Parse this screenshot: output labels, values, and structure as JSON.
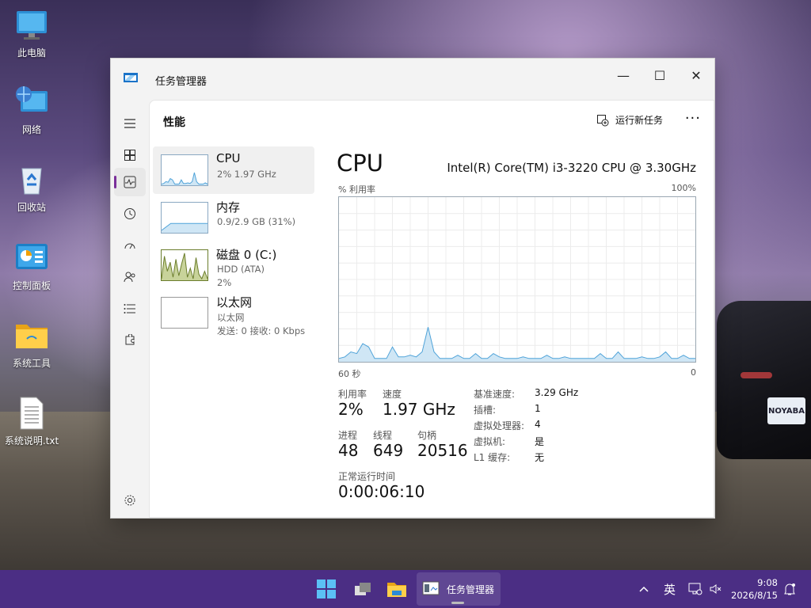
{
  "desktop": {
    "icons": [
      {
        "label": "此电脑"
      },
      {
        "label": "网络"
      },
      {
        "label": "回收站"
      },
      {
        "label": "控制面板"
      },
      {
        "label": "系统工具"
      },
      {
        "label": "系统说明.txt"
      }
    ],
    "car_plate": "NOYABA"
  },
  "window": {
    "title": "任务管理器",
    "controls": {
      "minimize": "—",
      "maximize": "☐",
      "close": "✕"
    }
  },
  "header": {
    "page_title": "性能",
    "run_task_label": "运行新任务",
    "more": "···"
  },
  "resources": [
    {
      "name": "CPU",
      "line1": "2% 1.97 GHz",
      "line2": ""
    },
    {
      "name": "内存",
      "line1": "0.9/2.9 GB (31%)",
      "line2": ""
    },
    {
      "name": "磁盘 0 (C:)",
      "line1": "HDD (ATA)",
      "line2": "2%"
    },
    {
      "name": "以太网",
      "line1": "以太网",
      "line2": "发送: 0 接收: 0 Kbps"
    }
  ],
  "detail": {
    "title": "CPU",
    "model": "Intel(R) Core(TM) i3-3220 CPU @ 3.30GHz",
    "util_label": "% 利用率",
    "util_max": "100%",
    "axis_left": "60 秒",
    "axis_right": "0",
    "stats": {
      "utilization_label": "利用率",
      "utilization": "2%",
      "speed_label": "速度",
      "speed": "1.97 GHz",
      "processes_label": "进程",
      "processes": "48",
      "threads_label": "线程",
      "threads": "649",
      "handles_label": "句柄",
      "handles": "20516",
      "uptime_label": "正常运行时间",
      "uptime": "0:00:06:10"
    },
    "info": [
      {
        "label": "基准速度:",
        "value": "3.29 GHz"
      },
      {
        "label": "插槽:",
        "value": "1"
      },
      {
        "label": "虚拟处理器:",
        "value": "4"
      },
      {
        "label": "虚拟机:",
        "value": "是"
      },
      {
        "label": "L1 缓存:",
        "value": "无"
      }
    ]
  },
  "chart_data": {
    "type": "area",
    "title": "CPU",
    "ylabel": "% 利用率",
    "xlabel": "",
    "x_range": [
      "60 秒",
      "0"
    ],
    "ylim": [
      0,
      100
    ],
    "grid": true,
    "color": "#4fa3d9",
    "values": [
      2,
      3,
      6,
      5,
      11,
      9,
      2,
      2,
      2,
      9,
      3,
      3,
      4,
      3,
      6,
      21,
      6,
      2,
      2,
      2,
      4,
      2,
      2,
      5,
      2,
      2,
      5,
      3,
      2,
      2,
      2,
      3,
      2,
      2,
      2,
      4,
      2,
      2,
      3,
      2,
      2,
      2,
      2,
      2,
      5,
      2,
      2,
      6,
      2,
      2,
      2,
      3,
      2,
      2,
      3,
      6,
      2,
      2,
      4,
      2,
      2
    ]
  },
  "thumb_data": {
    "cpu": [
      2,
      3,
      6,
      5,
      11,
      9,
      2,
      2,
      2,
      9,
      3,
      3,
      4,
      3,
      6,
      21,
      6,
      2,
      2,
      2,
      4,
      2
    ],
    "mem": [
      8,
      31,
      31,
      31,
      31,
      31
    ],
    "disk": [
      5,
      80,
      30,
      60,
      10,
      70,
      15,
      55,
      90,
      10,
      40,
      5,
      75,
      20,
      5,
      30,
      5
    ]
  },
  "taskbar": {
    "active_app_label": "任务管理器",
    "ime": "英",
    "time": "9:08",
    "date": "2026/8/15"
  },
  "colors": {
    "accent": "#7a2f9a",
    "cpu_line": "#4fa3d9",
    "cpu_fill": "#cfe6f5",
    "disk_line": "#6b7d2c",
    "disk_fill": "#c8d39a",
    "taskbar": "#4b2e84"
  }
}
